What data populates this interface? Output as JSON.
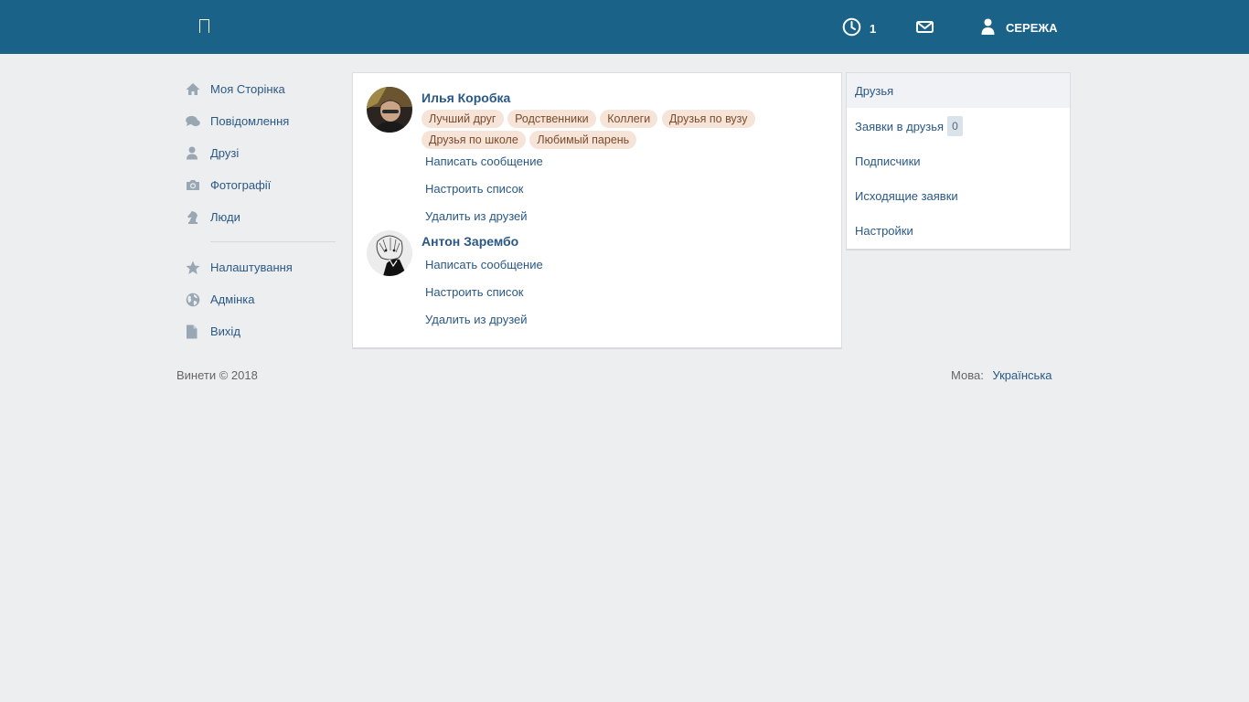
{
  "header": {
    "notifications_count": "1",
    "user_name": "СЕРЕЖА",
    "brand_color": "#1a6287"
  },
  "leftnav": {
    "items": [
      {
        "label": "Моя Сторінка",
        "icon": "home-icon"
      },
      {
        "label": "Повідомлення",
        "icon": "chat-bubbles-icon"
      },
      {
        "label": "Друзі",
        "icon": "person-icon"
      },
      {
        "label": "Фотографії",
        "icon": "camera-icon"
      },
      {
        "label": "Люди",
        "icon": "chess-knight-icon"
      }
    ],
    "items2": [
      {
        "label": "Налаштування",
        "icon": "star-icon"
      },
      {
        "label": "Адмінка",
        "icon": "globe-icon"
      },
      {
        "label": "Вихід",
        "icon": "document-icon"
      }
    ]
  },
  "friends": [
    {
      "name": "Илья Коробка",
      "tags": [
        "Лучший друг",
        "Родственники",
        "Коллеги",
        "Друзья по вузу",
        "Друзья по школе",
        "Любимый парень"
      ],
      "actions": [
        "Написать сообщение",
        "Настроить список",
        "Удалить из друзей"
      ]
    },
    {
      "name": "Антон Зарембо",
      "tags": [],
      "actions": [
        "Написать сообщение",
        "Настроить список",
        "Удалить из друзей"
      ]
    }
  ],
  "rightmenu": {
    "items": [
      "Друзья",
      "Заявки в друзья",
      "Подписчики",
      "Исходящие заявки",
      "Настройки"
    ],
    "requests_count": "0"
  },
  "footer": {
    "copyright": "Винети © 2018",
    "lang_label": "Мова:",
    "lang_value": "Українська"
  }
}
